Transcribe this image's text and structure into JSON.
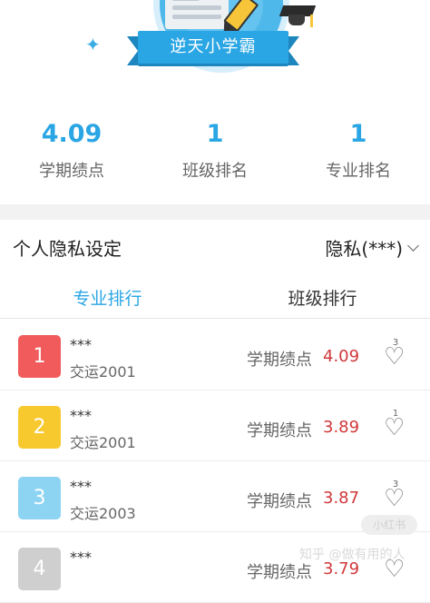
{
  "badge": {
    "title": "逆天小学霸"
  },
  "stats": [
    {
      "value": "4.09",
      "label": "学期绩点"
    },
    {
      "value": "1",
      "label": "班级排名"
    },
    {
      "value": "1",
      "label": "专业排名"
    }
  ],
  "privacy": {
    "title": "个人隐私设定",
    "value": "隐私(***)"
  },
  "tabs": [
    {
      "label": "专业排行",
      "active": true
    },
    {
      "label": "班级排行",
      "active": false
    }
  ],
  "gpa_label": "学期绩点",
  "rows": [
    {
      "rank": "1",
      "name": "***",
      "class": "交运2001",
      "gpa": "4.09",
      "likes": "3",
      "color": "#f15b5b"
    },
    {
      "rank": "2",
      "name": "***",
      "class": "交运2001",
      "gpa": "3.89",
      "likes": "1",
      "color": "#f7c92e"
    },
    {
      "rank": "3",
      "name": "***",
      "class": "交运2003",
      "gpa": "3.87",
      "likes": "3",
      "color": "#8dd4f3"
    },
    {
      "rank": "4",
      "name": "***",
      "class": "",
      "gpa": "3.79",
      "likes": "",
      "color": "#cfcfcf"
    }
  ],
  "colors": {
    "accent": "#2aa6e4",
    "gpa": "#d0383b"
  },
  "watermark": {
    "text": "知乎 @做有用的人",
    "badge": "小红书"
  }
}
